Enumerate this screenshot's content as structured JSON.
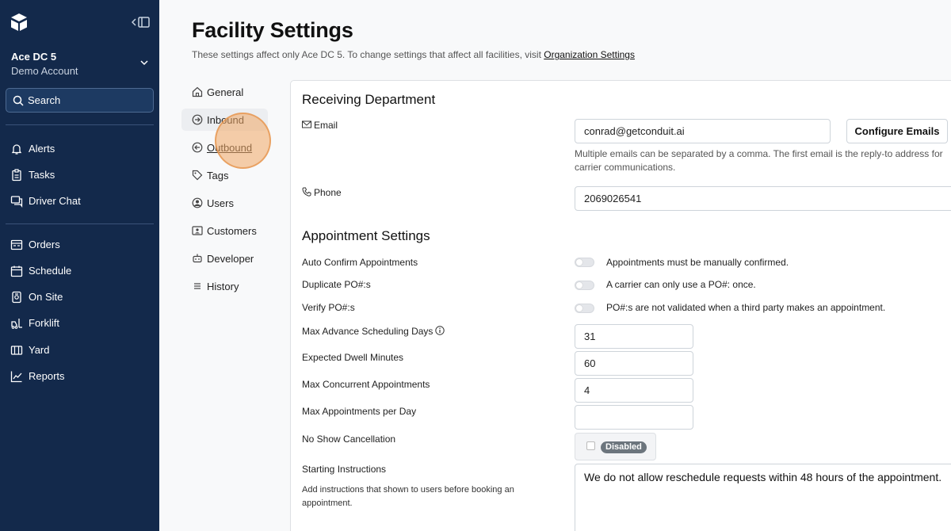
{
  "sidebar": {
    "account_name": "Ace DC 5",
    "account_sub": "Demo Account",
    "search_label": "Search",
    "group1": [
      {
        "label": "Alerts",
        "icon": "bell-icon"
      },
      {
        "label": "Tasks",
        "icon": "clipboard-icon"
      },
      {
        "label": "Driver Chat",
        "icon": "chat-icon"
      }
    ],
    "group2": [
      {
        "label": "Orders",
        "icon": "orders-icon"
      },
      {
        "label": "Schedule",
        "icon": "calendar-icon"
      },
      {
        "label": "On Site",
        "icon": "onsite-icon"
      },
      {
        "label": "Forklift",
        "icon": "forklift-icon"
      },
      {
        "label": "Yard",
        "icon": "yard-icon"
      },
      {
        "label": "Reports",
        "icon": "chart-line-icon"
      }
    ]
  },
  "page": {
    "title": "Facility Settings",
    "subtitle_text": "These settings affect only Ace DC 5. To change settings that affect all facilities, visit ",
    "subtitle_link": "Organization Settings"
  },
  "subnav": [
    {
      "label": "General",
      "icon": "home-icon"
    },
    {
      "label": "Inbound",
      "icon": "arrow-right-circle-icon"
    },
    {
      "label": "Outbound",
      "icon": "arrow-left-circle-icon"
    },
    {
      "label": "Tags",
      "icon": "tag-icon"
    },
    {
      "label": "Users",
      "icon": "user-circle-icon"
    },
    {
      "label": "Customers",
      "icon": "contact-card-icon"
    },
    {
      "label": "Developer",
      "icon": "robot-icon"
    },
    {
      "label": "History",
      "icon": "list-icon"
    }
  ],
  "receiving": {
    "title": "Receiving Department",
    "email_label": "Email",
    "email_value": "conrad@getconduit.ai",
    "configure_button": "Configure Emails",
    "email_help": "Multiple emails can be separated by a comma. The first email is the reply-to address for carrier communications.",
    "phone_label": "Phone",
    "phone_value": "2069026541"
  },
  "appointments": {
    "title": "Appointment Settings",
    "auto_confirm": {
      "label": "Auto Confirm Appointments",
      "enabled": false,
      "desc": "Appointments must be manually confirmed."
    },
    "duplicate_po": {
      "label": "Duplicate PO#:s",
      "enabled": false,
      "desc": "A carrier can only use a PO#: once."
    },
    "verify_po": {
      "label": "Verify PO#:s",
      "enabled": false,
      "desc": "PO#:s are not validated when a third party makes an appointment."
    },
    "max_advance": {
      "label": "Max Advance Scheduling Days",
      "value": "31"
    },
    "dwell": {
      "label": "Expected Dwell Minutes",
      "value": "60"
    },
    "concurrent": {
      "label": "Max Concurrent Appointments",
      "value": "4"
    },
    "per_day": {
      "label": "Max Appointments per Day",
      "value": ""
    },
    "no_show": {
      "label": "No Show Cancellation",
      "badge": "Disabled"
    },
    "instructions": {
      "label": "Starting Instructions",
      "help": "Add instructions that shown to users before booking an appointment.",
      "value": "We do not allow reschedule requests within 48 hours of the appointment."
    }
  }
}
